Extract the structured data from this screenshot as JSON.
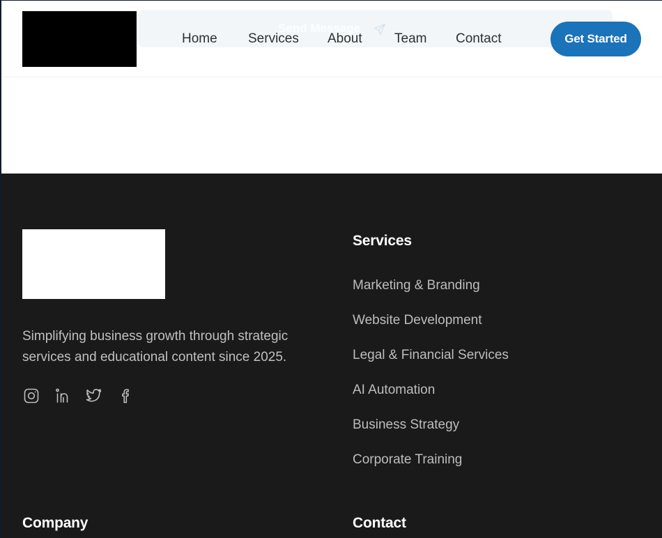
{
  "header": {
    "ghost_action_label": "Send Message",
    "nav": [
      {
        "label": "Home"
      },
      {
        "label": "Services"
      },
      {
        "label": "About"
      },
      {
        "label": "Team"
      },
      {
        "label": "Contact"
      }
    ],
    "cta_label": "Get Started"
  },
  "footer": {
    "tagline": "Simplifying business growth through strategic services and educational content since 2025.",
    "social": [
      {
        "icon": "instagram-icon"
      },
      {
        "icon": "linkedin-icon"
      },
      {
        "icon": "twitter-icon"
      },
      {
        "icon": "facebook-icon"
      }
    ],
    "services_heading": "Services",
    "services": [
      "Marketing & Branding",
      "Website Development",
      "Legal & Financial Services",
      "AI Automation",
      "Business Strategy",
      "Corporate Training"
    ],
    "company_heading": "Company",
    "contact_heading": "Contact"
  },
  "colors": {
    "accent": "#1b73b9",
    "footer_bg": "#1a1a1a",
    "footer_text": "#bdbdbd"
  }
}
